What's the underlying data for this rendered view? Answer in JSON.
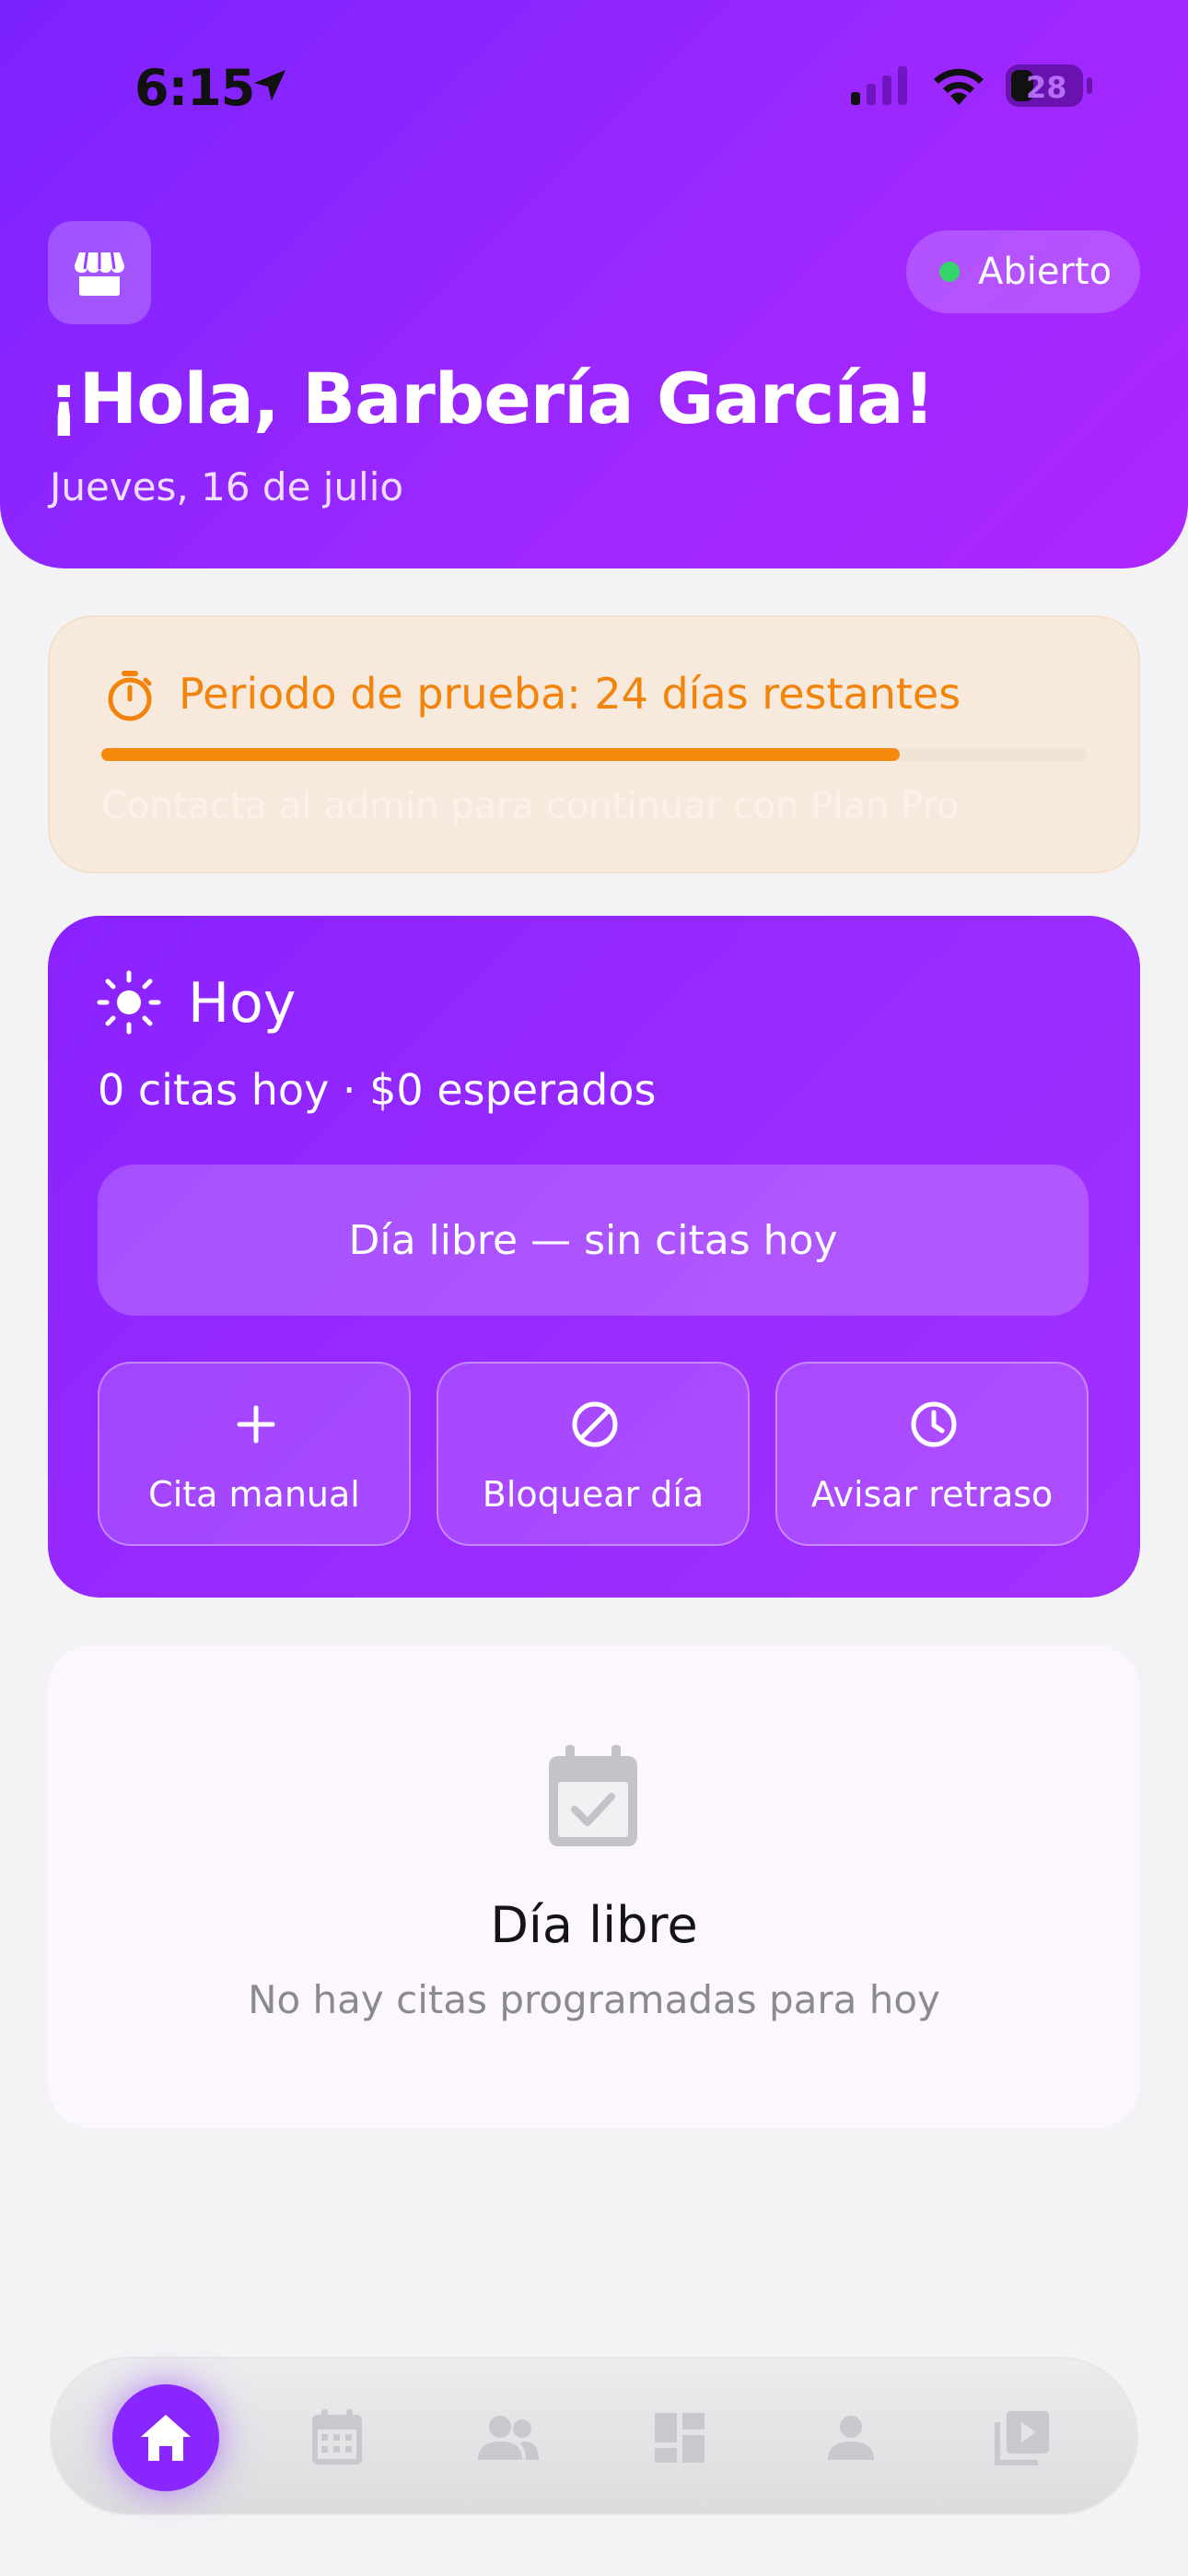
{
  "status_bar": {
    "time": "6:15",
    "battery": "28"
  },
  "header": {
    "store_icon": "store-icon",
    "status_badge": "Abierto",
    "status_color": "#35d46b",
    "greeting": "¡Hola, Barbería García!",
    "date": "Jueves, 16 de julio"
  },
  "trial": {
    "icon": "stopwatch-icon",
    "title": "Periodo de prueba: 24 días restantes",
    "note": "Contacta al admin para continuar con Plan Pro",
    "progress": 0.81,
    "accent": "#f58a0e"
  },
  "today": {
    "icon": "sun-icon",
    "title": "Hoy",
    "summary": "0 citas hoy · $0 esperados",
    "banner": "Día libre — sin citas hoy",
    "actions": [
      {
        "icon": "plus-icon",
        "label": "Cita manual"
      },
      {
        "icon": "block-icon",
        "label": "Bloquear día"
      },
      {
        "icon": "clock-icon",
        "label": "Avisar retraso"
      }
    ]
  },
  "empty_state": {
    "icon": "calendar-check-icon",
    "title": "Día libre",
    "subtitle": "No hay citas programadas para hoy"
  },
  "tabbar": {
    "active_color": "#8a26ff",
    "tabs": [
      {
        "icon": "home-icon",
        "active": true
      },
      {
        "icon": "calendar-icon",
        "active": false
      },
      {
        "icon": "people-icon",
        "active": false
      },
      {
        "icon": "dashboard-icon",
        "active": false
      },
      {
        "icon": "person-icon",
        "active": false
      },
      {
        "icon": "video-library-icon",
        "active": false
      }
    ]
  }
}
